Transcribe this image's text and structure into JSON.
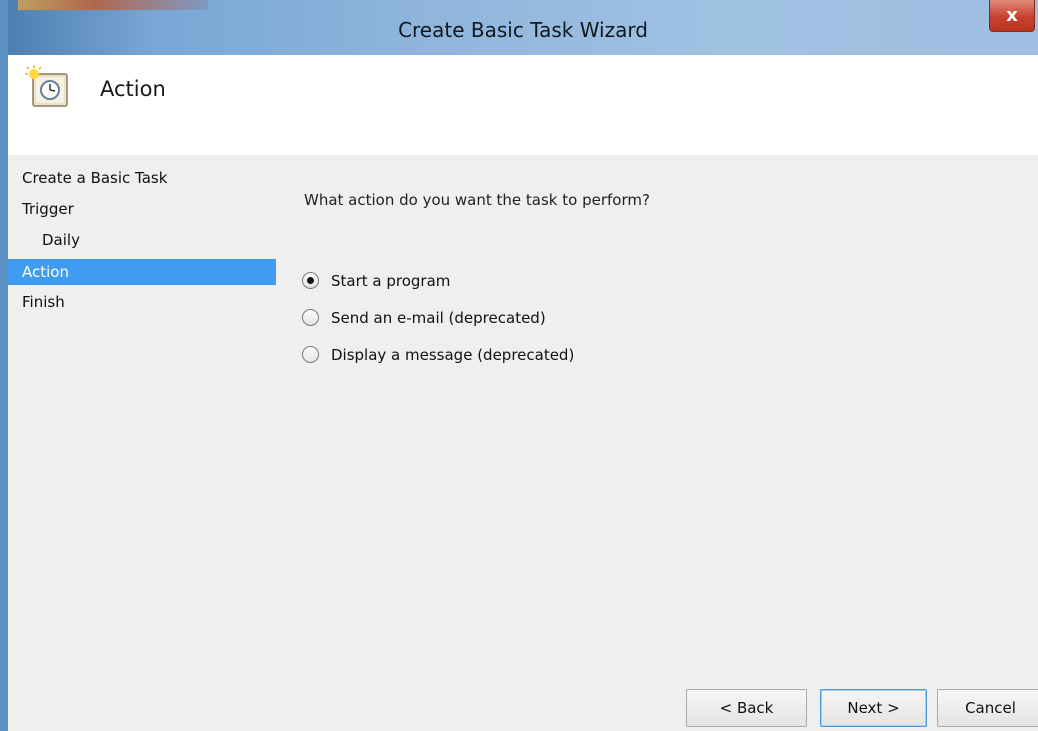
{
  "window": {
    "title": "Create Basic Task Wizard",
    "close_glyph": "x"
  },
  "header": {
    "title": "Action",
    "icon": "task-scheduler-clock-icon"
  },
  "sidebar": {
    "items": [
      {
        "label": "Create a Basic Task"
      },
      {
        "label": "Trigger"
      },
      {
        "label": "Daily"
      },
      {
        "label": "Action"
      },
      {
        "label": "Finish"
      }
    ]
  },
  "content": {
    "question": "What action do you want the task to perform?",
    "options": [
      {
        "label": "Start a program",
        "selected": true
      },
      {
        "label": "Send an e-mail (deprecated)",
        "selected": false
      },
      {
        "label": "Display a message (deprecated)",
        "selected": false
      }
    ]
  },
  "buttons": {
    "back": "< Back",
    "next": "Next >",
    "cancel": "Cancel"
  },
  "colors": {
    "accent": "#3f9cf0",
    "titlebar": "#8fb5dc",
    "close": "#c7432e"
  }
}
